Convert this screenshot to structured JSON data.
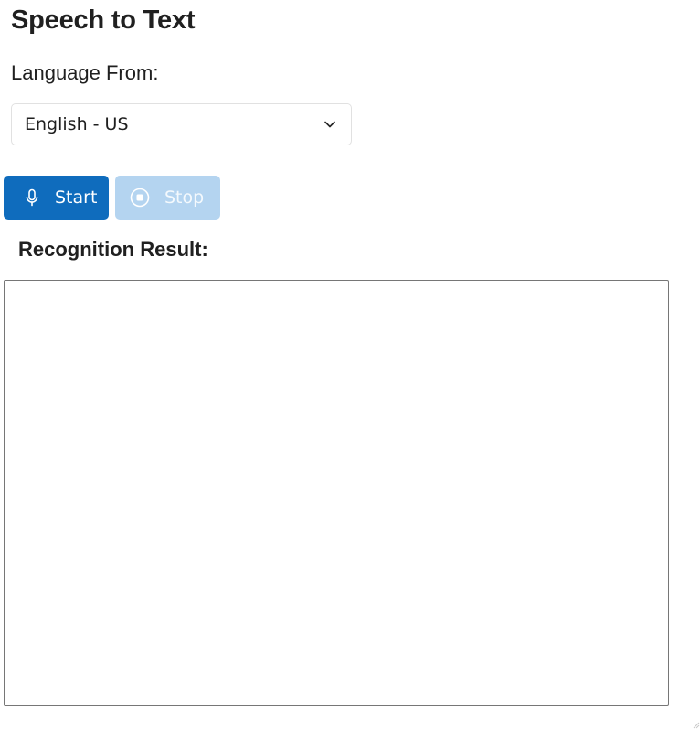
{
  "page": {
    "title": "Speech to Text"
  },
  "language": {
    "label": "Language From:",
    "selected": "English - US",
    "chevron_icon": "chevron-down-icon"
  },
  "controls": {
    "start": {
      "label": "Start",
      "icon": "microphone-icon",
      "enabled": true
    },
    "stop": {
      "label": "Stop",
      "icon": "record-stop-icon",
      "enabled": false
    }
  },
  "result": {
    "heading": "Recognition Result:",
    "text": ""
  },
  "colors": {
    "primary": "#0f6cbd",
    "primary_disabled": "#b4d4f0",
    "text": "#202020",
    "border": "#767676"
  }
}
